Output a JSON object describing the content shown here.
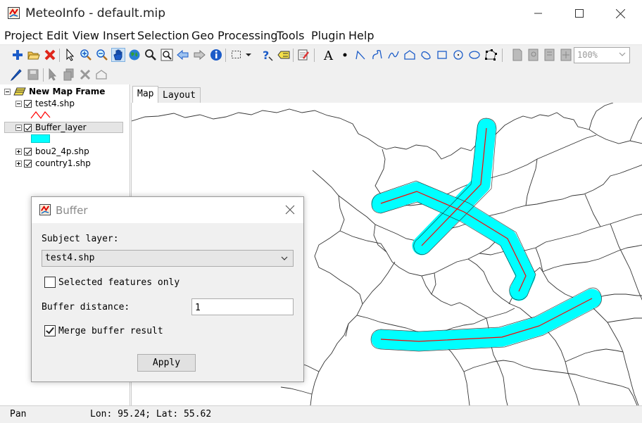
{
  "window": {
    "title": "MeteoInfo - default.mip"
  },
  "menu": [
    "Project",
    "Edit",
    "View",
    "Insert",
    "Selection",
    "Geo Processing",
    "Tools",
    "Plugin",
    "Help"
  ],
  "toolbar": {
    "zoom_value": "100%"
  },
  "layers": {
    "frame": "New Map Frame",
    "items": [
      {
        "label": "test4.shp",
        "checked": true
      },
      {
        "label": "Buffer_layer",
        "checked": true
      },
      {
        "label": "bou2_4p.shp",
        "checked": true
      },
      {
        "label": "country1.shp",
        "checked": true
      }
    ]
  },
  "tabs": [
    "Map",
    "Layout"
  ],
  "status": {
    "mode": "Pan",
    "coords": "Lon: 95.24; Lat: 55.62"
  },
  "dialog": {
    "title": "Buffer",
    "subject_layer_label": "Subject layer:",
    "subject_layer_value": "test4.shp",
    "selected_only_label": "Selected features only",
    "selected_only": false,
    "distance_label": "Buffer distance:",
    "distance_value": "1",
    "merge_label": "Merge buffer result",
    "merge": true,
    "apply_label": "Apply"
  },
  "colors": {
    "buffer_fill": "#00ffff",
    "line": "#ff0000",
    "border": "#333333"
  }
}
